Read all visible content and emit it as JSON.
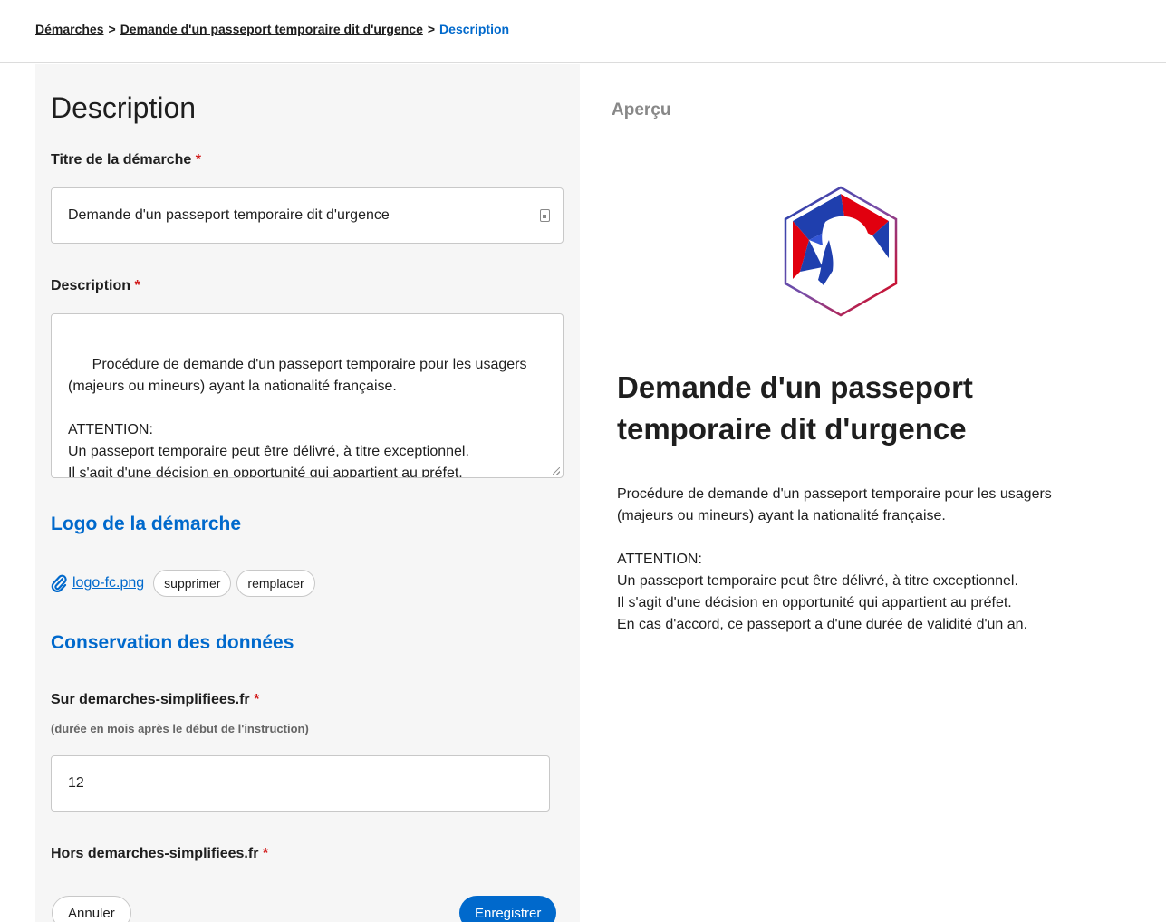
{
  "breadcrumb": {
    "items": [
      "Démarches",
      "Demande d'un passeport temporaire dit d'urgence"
    ],
    "separator": ">",
    "current": "Description"
  },
  "form": {
    "page_title": "Description",
    "title_field": {
      "label": "Titre de la démarche",
      "required_marker": "*",
      "value": "Demande d'un passeport temporaire dit d'urgence"
    },
    "description_field": {
      "label": "Description",
      "required_marker": "*",
      "value": "Procédure de demande d'un passeport temporaire pour les usagers (majeurs ou mineurs) ayant la nationalité française.\n\nATTENTION:\nUn passeport temporaire peut être délivré, à titre exceptionnel.\nIl s'agit d'une décision en opportunité qui appartient au préfet.\nEn cas d'accord, ce passeport a d'une durée de validité d'un an."
    },
    "logo_section": {
      "title": "Logo de la démarche",
      "filename": "logo-fc.png",
      "delete_label": "supprimer",
      "replace_label": "remplacer",
      "icon": "paperclip-icon"
    },
    "retention_section": {
      "title": "Conservation des données",
      "on_site": {
        "label": "Sur demarches-simplifiees.fr",
        "required_marker": "*",
        "hint": "(durée en mois après le début de l'instruction)",
        "value": "12"
      },
      "off_site": {
        "label": "Hors demarches-simplifiees.fr",
        "required_marker": "*"
      }
    }
  },
  "footer": {
    "cancel_label": "Annuler",
    "save_label": "Enregistrer"
  },
  "preview": {
    "label": "Aperçu",
    "title": "Demande d'un passeport temporaire dit d'urgence",
    "description": "Procédure de demande d'un passeport temporaire pour les usagers (majeurs ou mineurs) ayant la nationalité française.\n\nATTENTION:\nUn passeport temporaire peut être délivré, à titre exceptionnel.\nIl s'agit d'une décision en opportunité qui appartient au préfet.\nEn cas d'accord, ce passeport a d'une durée de validité d'un an."
  },
  "colors": {
    "accent": "#0069cc",
    "required": "#d21c1c",
    "panel_bg": "#f6f6f6"
  }
}
